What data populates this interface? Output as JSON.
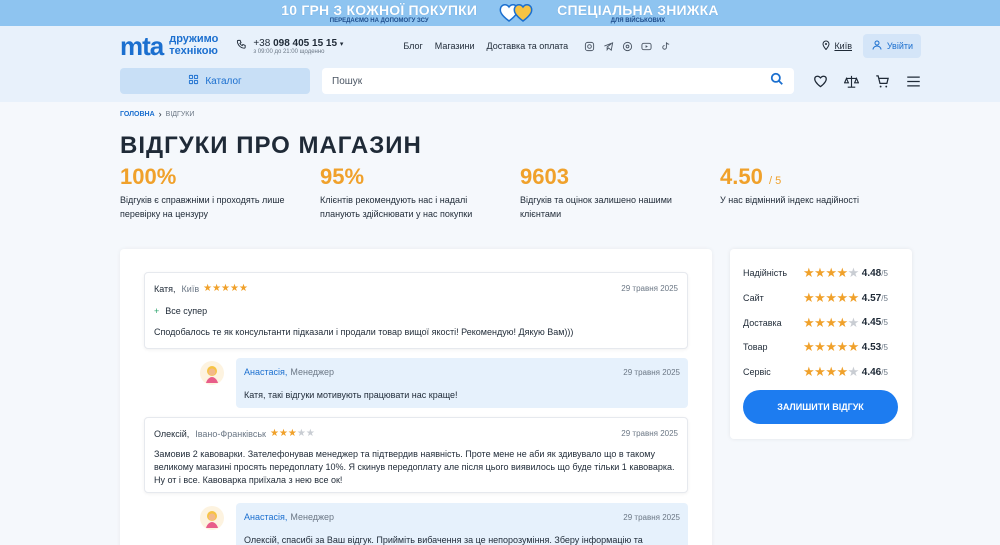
{
  "promo": {
    "left_main": "10 ГРН З КОЖНОЇ ПОКУПКИ",
    "left_sub": "ПЕРЕДАЄМО НА ДОПОМОГУ ЗСУ",
    "right_main": "СПЕЦІАЛЬНА ЗНИЖКА",
    "right_sub": "ДЛЯ ВІЙСЬКОВИХ"
  },
  "header": {
    "logo": "mta",
    "logo_tagline_1": "дружимо",
    "logo_tagline_2": "технікою",
    "phone_prefix": "+38",
    "phone_number": "098 405 15 15",
    "phone_hours": "з 09:00 до 21:00 щоденно",
    "nav": [
      "Блог",
      "Магазини",
      "Доставка та оплата"
    ],
    "city": "Київ",
    "login": "Увійти"
  },
  "search": {
    "catalog": "Каталог",
    "placeholder": "Пошук"
  },
  "breadcrumb": {
    "home": "ГОЛОВНА",
    "separator": "›",
    "current": "ВІДГУКИ"
  },
  "page_title": "ВІДГУКИ ПРО МАГАЗИН",
  "stats": [
    {
      "value": "100%",
      "suffix": "",
      "desc": "Відгуків є справжніми і проходять лише перевірку на цензуру"
    },
    {
      "value": "95%",
      "suffix": "",
      "desc": "Клієнтів рекомендують нас і надалі планують здійснювати у нас покупки"
    },
    {
      "value": "9603",
      "suffix": "",
      "desc": "Відгуків та оцінок залишено нашими клієнтами"
    },
    {
      "value": "4.50",
      "suffix": "/ 5",
      "desc": "У нас відмінний індекс надійності"
    }
  ],
  "reviews": [
    {
      "name": "Катя,",
      "city": "Київ",
      "stars": 5,
      "date": "29 травня 2025",
      "plus": "Все супер",
      "text": "Сподобалось те як консультанти підказали і продали товар вищої якості! Рекомендую! Дякую Вам)))"
    },
    {
      "name": "Олексій,",
      "city": "Івано-Франківськ",
      "stars": 3,
      "date": "29 травня 2025",
      "text": "Замовив 2 кавоварки. Зателефонував менеджер та підтвердив наявність. Проте мене не аби як здивувало що в такому великому магазині просять передоплату 10%. Я скинув передоплату але після цього виявилось що буде тільки 1 кавоварка. Ну от і все. Кавоварка приїхала з нею все ок!"
    }
  ],
  "replies": [
    {
      "name": "Анастасія,",
      "role": "Менеджер",
      "date": "29 травня 2025",
      "text": "Катя, такі відгуки мотивують працювати нас краще!"
    },
    {
      "name": "Анастасія,",
      "role": "Менеджер",
      "date": "29 травня 2025",
      "text": "Олексій, спасибі за Ваш відгук. Прийміть вибачення за це непорозуміння. Зберу інформацію та"
    }
  ],
  "ratings": [
    {
      "label": "Надійність",
      "value": "4.48",
      "stars": 4
    },
    {
      "label": "Сайт",
      "value": "4.57",
      "stars": 5
    },
    {
      "label": "Доставка",
      "value": "4.45",
      "stars": 4
    },
    {
      "label": "Товар",
      "value": "4.53",
      "stars": 5
    },
    {
      "label": "Сервіс",
      "value": "4.46",
      "stars": 4
    }
  ],
  "rating_max": "/5",
  "leave_review": "ЗАЛИШИТИ ВІДГУК",
  "colors": {
    "accent": "#1d7cf0",
    "star": "#f0a12b",
    "brand": "#1b6fcf"
  }
}
